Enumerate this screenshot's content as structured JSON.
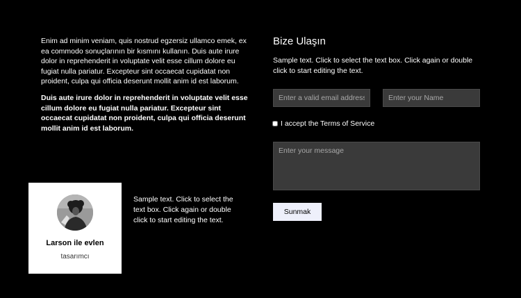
{
  "about": {
    "paragraph": "Enim ad minim veniam, quis nostrud egzersiz ullamco emek, ex ea commodo sonuçlarının bir kısmını kullanın. Duis aute irure dolor in reprehenderit in voluptate velit esse cillum dolore eu fugiat nulla pariatur. Excepteur sint occaecat cupidatat non proident, culpa qui officia deserunt mollit anim id est laborum.",
    "bold_paragraph": "Duis aute irure dolor in reprehenderit in voluptate velit esse cillum dolore eu fugiat nulla pariatur. Excepteur sint occaecat cupidatat non proident, culpa qui officia deserunt mollit anim id est laborum."
  },
  "profile": {
    "name": "Larson ile evlen",
    "title": "tasarımcı",
    "side_text": "Sample text. Click to select the text box. Click again or double click to start editing the text."
  },
  "contact": {
    "heading": "Bize Ulaşın",
    "description": "Sample text. Click to select the text box. Click again or double click to start editing the text.",
    "email_placeholder": "Enter a valid email address",
    "name_placeholder": "Enter your Name",
    "terms_label": "I accept the Terms of Service",
    "message_placeholder": "Enter your message",
    "submit_label": "Sunmak"
  }
}
